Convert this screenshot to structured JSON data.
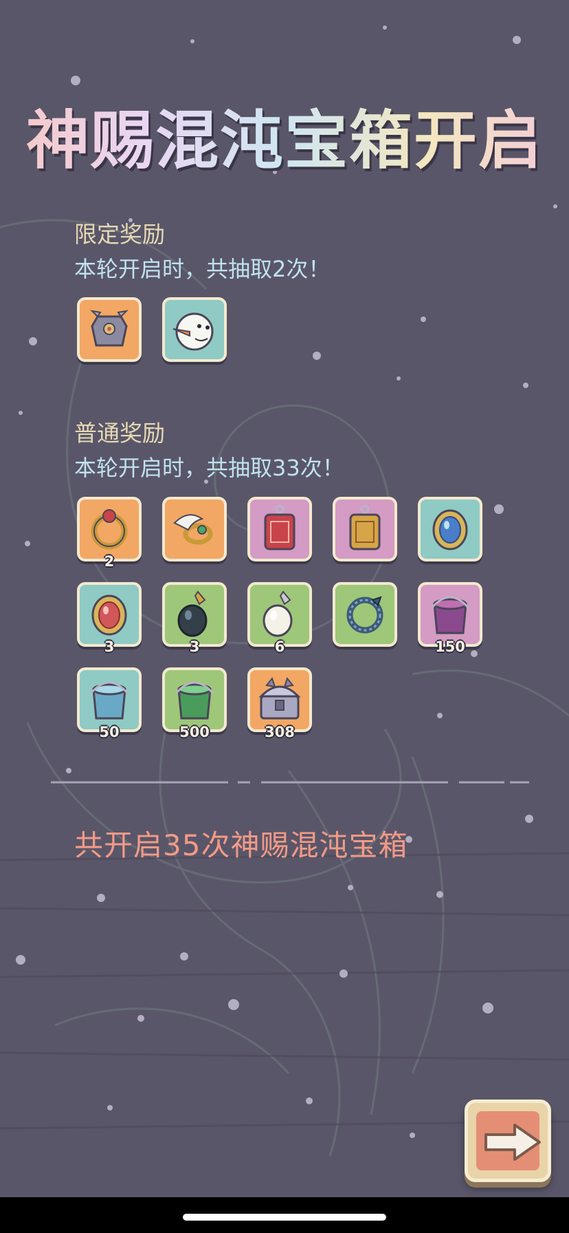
{
  "title": "神赐混沌宝箱开启",
  "limited": {
    "heading": "限定奖励",
    "subtitle": "本轮开启时，共抽取2次！",
    "items": [
      {
        "icon": "armor-chest-icon",
        "bg": "orange",
        "qty": ""
      },
      {
        "icon": "snowman-head-icon",
        "bg": "teal",
        "qty": ""
      }
    ]
  },
  "normal": {
    "heading": "普通奖励",
    "subtitle": "本轮开启时，共抽取33次！",
    "items": [
      {
        "icon": "red-gem-ring-icon",
        "bg": "orange",
        "qty": "2"
      },
      {
        "icon": "winged-ring-icon",
        "bg": "orange",
        "qty": ""
      },
      {
        "icon": "red-charm-pendant-icon",
        "bg": "pink",
        "qty": ""
      },
      {
        "icon": "gold-charm-pendant-icon",
        "bg": "pink",
        "qty": ""
      },
      {
        "icon": "blue-gem-amulet-icon",
        "bg": "teal",
        "qty": ""
      },
      {
        "icon": "red-gem-amulet-icon",
        "bg": "teal",
        "qty": "3"
      },
      {
        "icon": "black-pearl-pendant-icon",
        "bg": "green",
        "qty": "3"
      },
      {
        "icon": "white-pearl-pendant-icon",
        "bg": "green",
        "qty": "6"
      },
      {
        "icon": "serpent-ring-icon",
        "bg": "green",
        "qty": ""
      },
      {
        "icon": "purple-paint-bucket-icon",
        "bg": "pink",
        "qty": "150"
      },
      {
        "icon": "blue-paint-bucket-icon",
        "bg": "teal",
        "qty": "50"
      },
      {
        "icon": "green-paint-bucket-icon",
        "bg": "green",
        "qty": "500"
      },
      {
        "icon": "silver-chest-icon",
        "bg": "orange",
        "qty": "308"
      }
    ]
  },
  "total": "共开启35次神赐混沌宝箱",
  "next_button": {
    "icon": "right-arrow-icon"
  },
  "colors": {
    "orange": "#f2a764",
    "teal": "#8fcac4",
    "pink": "#d49bc4",
    "green": "#9ec77a",
    "total_text": "#f29a86"
  }
}
